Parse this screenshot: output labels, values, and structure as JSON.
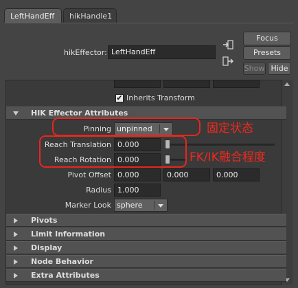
{
  "tabs": [
    {
      "label": "LeftHandEff",
      "active": true
    },
    {
      "label": "hikHandle1",
      "active": false
    }
  ],
  "node": {
    "type_label": "hikEffector:",
    "name_value": "LeftHandEff"
  },
  "buttons": {
    "focus": "Focus",
    "presets": "Presets",
    "show": "Show",
    "hide": "Hide"
  },
  "icons": {
    "focus": "focus-arrow-icon",
    "select": "select-node-icon"
  },
  "transform": {
    "inherits_label": "Inherits Transform",
    "inherits_checked": true,
    "check_glyph": "✔"
  },
  "hik_section": {
    "title": "HIK Effector Attributes",
    "pinning_label": "Pinning",
    "pinning_value": "unpinned",
    "reach_translation_label": "Reach Translation",
    "reach_translation_value": "0.000",
    "reach_translation_fraction": 0.0,
    "reach_rotation_label": "Reach Rotation",
    "reach_rotation_value": "0.000",
    "reach_rotation_fraction": 0.0,
    "pivot_offset_label": "Pivot Offset",
    "pivot_offset": [
      "0.000",
      "0.000",
      "0.000"
    ],
    "radius_label": "Radius",
    "radius_value": "1.000",
    "marker_look_label": "Marker Look",
    "marker_look_value": "sphere"
  },
  "collapsed_sections": [
    "Pivots",
    "Limit Information",
    "Display",
    "Node Behavior",
    "Extra Attributes"
  ],
  "annotations": {
    "pinning_note": "固定状态",
    "reach_note": "FK/IK融合程度",
    "color": "#e8261d"
  },
  "colors": {
    "background": "#444444",
    "panel": "#3a3a3a",
    "field": "#2b2b2b",
    "section_header": "#525252"
  }
}
